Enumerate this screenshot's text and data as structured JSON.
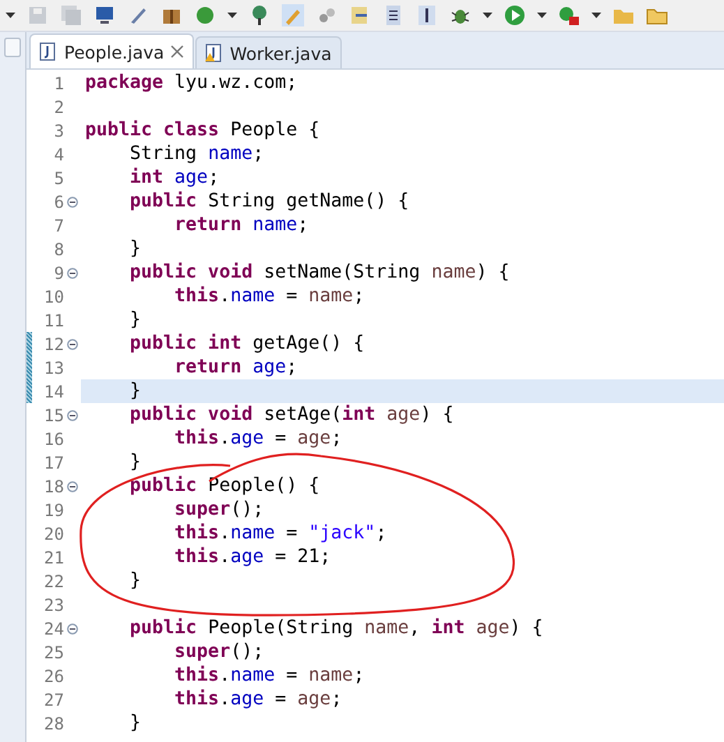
{
  "tabs": [
    {
      "label": "People.java",
      "selected": true,
      "warning": false
    },
    {
      "label": "Worker.java",
      "selected": false,
      "warning": true
    }
  ],
  "lines": [
    {
      "number": "1",
      "fold": false,
      "changed": false,
      "current": false,
      "tokens": [
        {
          "kind": "keyword",
          "text": "package "
        },
        {
          "kind": "plain",
          "text": "lyu.wz.com;"
        }
      ]
    },
    {
      "number": "2",
      "fold": false,
      "changed": false,
      "current": false
    },
    {
      "number": "3",
      "fold": false,
      "changed": false,
      "current": false,
      "tokens": [
        {
          "kind": "keyword",
          "text": "public class "
        },
        {
          "kind": "plain",
          "text": "People {"
        }
      ]
    },
    {
      "number": "4",
      "fold": false,
      "changed": false,
      "current": false,
      "tokens": [
        {
          "kind": "plain",
          "text": "    String "
        },
        {
          "kind": "field",
          "text": "name"
        },
        {
          "kind": "plain",
          "text": ";"
        }
      ]
    },
    {
      "number": "5",
      "fold": false,
      "changed": false,
      "current": false,
      "tokens": [
        {
          "kind": "keyword",
          "text": "    int "
        },
        {
          "kind": "field",
          "text": "age"
        },
        {
          "kind": "plain",
          "text": ";"
        }
      ]
    },
    {
      "number": "6",
      "fold": true,
      "changed": false,
      "current": false,
      "tokens": [
        {
          "kind": "keyword",
          "text": "    public "
        },
        {
          "kind": "plain",
          "text": "String getName() {"
        }
      ]
    },
    {
      "number": "7",
      "fold": false,
      "changed": false,
      "current": false,
      "tokens": [
        {
          "kind": "keyword",
          "text": "        return "
        },
        {
          "kind": "field",
          "text": "name"
        },
        {
          "kind": "plain",
          "text": ";"
        }
      ]
    },
    {
      "number": "8",
      "fold": false,
      "changed": false,
      "current": false,
      "tokens": [
        {
          "kind": "plain",
          "text": "    }"
        }
      ]
    },
    {
      "number": "9",
      "fold": true,
      "changed": false,
      "current": false,
      "tokens": [
        {
          "kind": "keyword",
          "text": "    public void "
        },
        {
          "kind": "plain",
          "text": "setName(String "
        },
        {
          "kind": "param",
          "text": "name"
        },
        {
          "kind": "plain",
          "text": ") {"
        }
      ]
    },
    {
      "number": "10",
      "fold": false,
      "changed": false,
      "current": false,
      "tokens": [
        {
          "kind": "keyword",
          "text": "        this"
        },
        {
          "kind": "plain",
          "text": "."
        },
        {
          "kind": "field",
          "text": "name"
        },
        {
          "kind": "plain",
          "text": " = "
        },
        {
          "kind": "param",
          "text": "name"
        },
        {
          "kind": "plain",
          "text": ";"
        }
      ]
    },
    {
      "number": "11",
      "fold": false,
      "changed": false,
      "current": false,
      "tokens": [
        {
          "kind": "plain",
          "text": "    }"
        }
      ]
    },
    {
      "number": "12",
      "fold": true,
      "changed": true,
      "current": false,
      "tokens": [
        {
          "kind": "keyword",
          "text": "    public int "
        },
        {
          "kind": "plain",
          "text": "getAge() {"
        }
      ]
    },
    {
      "number": "13",
      "fold": false,
      "changed": true,
      "current": false,
      "tokens": [
        {
          "kind": "keyword",
          "text": "        return "
        },
        {
          "kind": "field",
          "text": "age"
        },
        {
          "kind": "plain",
          "text": ";"
        }
      ]
    },
    {
      "number": "14",
      "fold": false,
      "changed": true,
      "current": true,
      "tokens": [
        {
          "kind": "plain",
          "text": "    }"
        }
      ]
    },
    {
      "number": "15",
      "fold": true,
      "changed": false,
      "current": false,
      "tokens": [
        {
          "kind": "keyword",
          "text": "    public void "
        },
        {
          "kind": "plain",
          "text": "setAge("
        },
        {
          "kind": "keyword",
          "text": "int "
        },
        {
          "kind": "param",
          "text": "age"
        },
        {
          "kind": "plain",
          "text": ") {"
        }
      ]
    },
    {
      "number": "16",
      "fold": false,
      "changed": false,
      "current": false,
      "tokens": [
        {
          "kind": "keyword",
          "text": "        this"
        },
        {
          "kind": "plain",
          "text": "."
        },
        {
          "kind": "field",
          "text": "age"
        },
        {
          "kind": "plain",
          "text": " = "
        },
        {
          "kind": "param",
          "text": "age"
        },
        {
          "kind": "plain",
          "text": ";"
        }
      ]
    },
    {
      "number": "17",
      "fold": false,
      "changed": false,
      "current": false,
      "tokens": [
        {
          "kind": "plain",
          "text": "    }"
        }
      ]
    },
    {
      "number": "18",
      "fold": true,
      "changed": false,
      "current": false,
      "tokens": [
        {
          "kind": "keyword",
          "text": "    public "
        },
        {
          "kind": "plain",
          "text": "People() {"
        }
      ]
    },
    {
      "number": "19",
      "fold": false,
      "changed": false,
      "current": false,
      "tokens": [
        {
          "kind": "keyword",
          "text": "        super"
        },
        {
          "kind": "plain",
          "text": "();"
        }
      ]
    },
    {
      "number": "20",
      "fold": false,
      "changed": false,
      "current": false,
      "tokens": [
        {
          "kind": "keyword",
          "text": "        this"
        },
        {
          "kind": "plain",
          "text": "."
        },
        {
          "kind": "field",
          "text": "name"
        },
        {
          "kind": "plain",
          "text": " = "
        },
        {
          "kind": "string",
          "text": "\"jack\""
        },
        {
          "kind": "plain",
          "text": ";"
        }
      ]
    },
    {
      "number": "21",
      "fold": false,
      "changed": false,
      "current": false,
      "tokens": [
        {
          "kind": "keyword",
          "text": "        this"
        },
        {
          "kind": "plain",
          "text": "."
        },
        {
          "kind": "field",
          "text": "age"
        },
        {
          "kind": "plain",
          "text": " = 21;"
        }
      ]
    },
    {
      "number": "22",
      "fold": false,
      "changed": false,
      "current": false,
      "tokens": [
        {
          "kind": "plain",
          "text": "    }"
        }
      ]
    },
    {
      "number": "23",
      "fold": false,
      "changed": false,
      "current": false
    },
    {
      "number": "24",
      "fold": true,
      "changed": false,
      "current": false,
      "tokens": [
        {
          "kind": "keyword",
          "text": "    public "
        },
        {
          "kind": "plain",
          "text": "People(String "
        },
        {
          "kind": "param",
          "text": "name"
        },
        {
          "kind": "plain",
          "text": ", "
        },
        {
          "kind": "keyword",
          "text": "int "
        },
        {
          "kind": "param",
          "text": "age"
        },
        {
          "kind": "plain",
          "text": ") {"
        }
      ]
    },
    {
      "number": "25",
      "fold": false,
      "changed": false,
      "current": false,
      "tokens": [
        {
          "kind": "keyword",
          "text": "        super"
        },
        {
          "kind": "plain",
          "text": "();"
        }
      ]
    },
    {
      "number": "26",
      "fold": false,
      "changed": false,
      "current": false,
      "tokens": [
        {
          "kind": "keyword",
          "text": "        this"
        },
        {
          "kind": "plain",
          "text": "."
        },
        {
          "kind": "field",
          "text": "name"
        },
        {
          "kind": "plain",
          "text": " = "
        },
        {
          "kind": "param",
          "text": "name"
        },
        {
          "kind": "plain",
          "text": ";"
        }
      ]
    },
    {
      "number": "27",
      "fold": false,
      "changed": false,
      "current": false,
      "tokens": [
        {
          "kind": "keyword",
          "text": "        this"
        },
        {
          "kind": "plain",
          "text": "."
        },
        {
          "kind": "field",
          "text": "age"
        },
        {
          "kind": "plain",
          "text": " = "
        },
        {
          "kind": "param",
          "text": "age"
        },
        {
          "kind": "plain",
          "text": ";"
        }
      ]
    },
    {
      "number": "28",
      "fold": false,
      "changed": false,
      "current": false,
      "tokens": [
        {
          "kind": "plain",
          "text": "    }"
        }
      ]
    }
  ]
}
